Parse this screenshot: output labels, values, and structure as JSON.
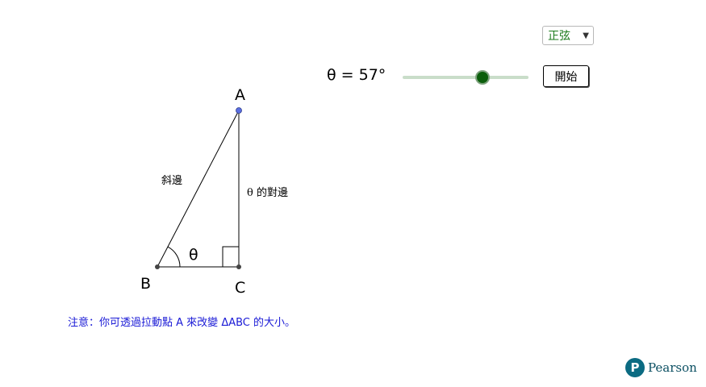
{
  "controls": {
    "function_select": {
      "selected": "正弦"
    },
    "theta": {
      "readout": "θ = 57°",
      "value_degrees": 57,
      "min_degrees": 0,
      "max_degrees": 90
    },
    "start_button": {
      "label": "開始"
    }
  },
  "triangle": {
    "vertex_a": "A",
    "vertex_b": "B",
    "vertex_c": "C",
    "hypotenuse_label": "斜邊",
    "opposite_label": "θ 的對邊",
    "angle_label": "θ"
  },
  "note": {
    "prefix": "注意：你可透過拉動點 ",
    "point": "A",
    "middle": " 來改變 ",
    "triangle": "ΔABC",
    "suffix": " 的大小。"
  },
  "brand": {
    "mark": "P",
    "name": "Pearson"
  },
  "colors": {
    "note_text": "#1a1ad6",
    "select_text": "#1b7a1b",
    "slider_knob": "#0b5e0b",
    "slider_track": "#c9ddc9",
    "point_a": "#5a6ee0",
    "brand": "#0b6b82"
  }
}
